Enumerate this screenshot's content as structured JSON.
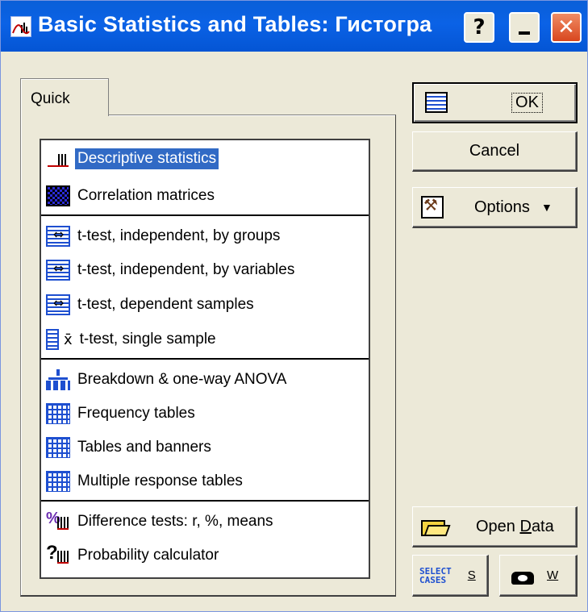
{
  "window": {
    "title": "Basic Statistics and Tables: Гистогра",
    "help_button": "?",
    "minimize_icon": "minimize-icon",
    "close_button": "✕",
    "colors": {
      "titlebar": "#0a5fd8",
      "selection": "#316ac5",
      "face": "#ece9d8"
    }
  },
  "tabs": [
    {
      "label": "Quick",
      "active": true
    }
  ],
  "analyses": [
    {
      "label": "Descriptive statistics",
      "icon": "descriptive-stats-icon",
      "selected": true
    },
    {
      "label": "Correlation matrices",
      "icon": "correlation-matrix-icon"
    },
    {
      "label": "t-test, independent, by groups",
      "icon": "ttest-groups-icon"
    },
    {
      "label": "t-test, independent, by variables",
      "icon": "ttest-variables-icon"
    },
    {
      "label": "t-test, dependent samples",
      "icon": "ttest-dependent-icon"
    },
    {
      "label": "t-test, single sample",
      "icon": "ttest-single-icon",
      "symbol": "x̄"
    },
    {
      "label": "Breakdown & one-way ANOVA",
      "icon": "breakdown-anova-icon"
    },
    {
      "label": "Frequency tables",
      "icon": "frequency-table-icon"
    },
    {
      "label": "Tables and banners",
      "icon": "tables-banners-icon"
    },
    {
      "label": "Multiple response tables",
      "icon": "multiple-response-icon"
    },
    {
      "label": "Difference tests: r, %, means",
      "icon": "difference-tests-icon"
    },
    {
      "label": "Probability calculator",
      "icon": "probability-calculator-icon"
    }
  ],
  "buttons": {
    "ok": "OK",
    "cancel": "Cancel",
    "options": "Options",
    "open_data_prefix": "Open ",
    "open_data_key": "D",
    "open_data_suffix": "ata",
    "select_cases_icon_line1": "SELECT",
    "select_cases_icon_line2": "CASES",
    "select_cases_key": "S",
    "weight_key": "W"
  }
}
